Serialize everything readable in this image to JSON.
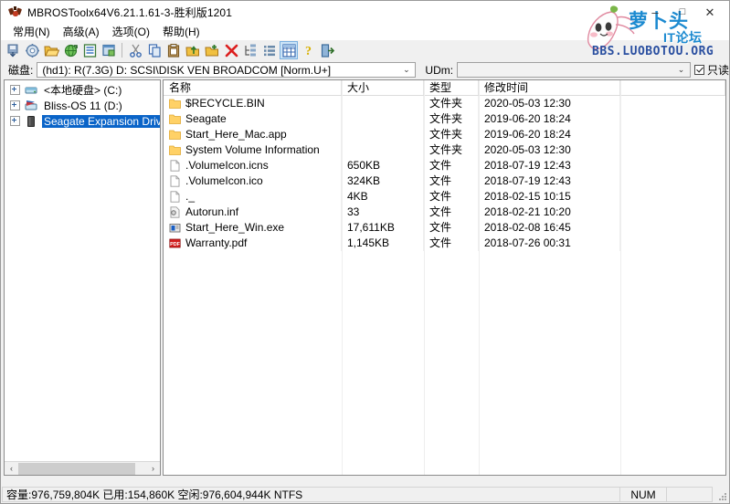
{
  "window": {
    "title": "MBROSToolx64V6.21.1.61-3-胜利版1201",
    "app_icon": "moth-icon",
    "minimize": "–",
    "maximize": "□",
    "close": "✕"
  },
  "menu": [
    {
      "label": "常用(N)",
      "name": "menu-common"
    },
    {
      "label": "高级(A)",
      "name": "menu-advanced"
    },
    {
      "label": "选项(O)",
      "name": "menu-options"
    },
    {
      "label": "帮助(H)",
      "name": "menu-help"
    }
  ],
  "toolbar": {
    "buttons": [
      {
        "name": "save-disk-icon"
      },
      {
        "name": "settings-gear-icon"
      },
      {
        "name": "open-folder-icon"
      },
      {
        "name": "refresh-globe-icon"
      },
      {
        "name": "list-properties-icon"
      },
      {
        "name": "export-window-icon"
      },
      {
        "name": "separator-1"
      },
      {
        "name": "cut-icon"
      },
      {
        "name": "copy-icon"
      },
      {
        "name": "paste-icon"
      },
      {
        "name": "upload-folder-icon"
      },
      {
        "name": "new-folder-icon"
      },
      {
        "name": "delete-x-icon"
      },
      {
        "name": "tree-view-icon"
      },
      {
        "name": "detail-list-icon"
      },
      {
        "name": "grid-view-icon"
      },
      {
        "name": "help-question-icon"
      },
      {
        "name": "exit-door-icon"
      }
    ],
    "active_index": 15
  },
  "disk_bar": {
    "label": "磁盘:",
    "value": "(hd1): R(7.3G)  D: SCSI\\DISK  VEN BROADCOM [Norm.U+]",
    "udm_label": "UDm:",
    "udm_value": "",
    "readonly_label": "只读",
    "readonly_checked": true,
    "dropdown_arrow": "⌄"
  },
  "tree": {
    "items": [
      {
        "label": "<本地硬盘> (C:)",
        "icon": "hdd-icon",
        "selected": false,
        "expander": "+"
      },
      {
        "label": "Bliss-OS 11 (D:)",
        "icon": "flag-drive-icon",
        "selected": false,
        "expander": "+"
      },
      {
        "label": "Seagate Expansion Drive (E",
        "icon": "external-drive-icon",
        "selected": true,
        "expander": "+"
      }
    ],
    "scroll_left": "‹",
    "scroll_right": "›"
  },
  "list": {
    "columns": [
      "名称",
      "大小",
      "类型",
      "修改时间"
    ],
    "rows": [
      {
        "name": "$RECYCLE.BIN",
        "size": "",
        "type": "文件夹",
        "time": "2020-05-03 12:30",
        "icon": "folder-icon"
      },
      {
        "name": "Seagate",
        "size": "",
        "type": "文件夹",
        "time": "2019-06-20 18:24",
        "icon": "folder-icon"
      },
      {
        "name": "Start_Here_Mac.app",
        "size": "",
        "type": "文件夹",
        "time": "2019-06-20 18:24",
        "icon": "folder-icon"
      },
      {
        "name": "System Volume Information",
        "size": "",
        "type": "文件夹",
        "time": "2020-05-03 12:30",
        "icon": "folder-icon"
      },
      {
        "name": ".VolumeIcon.icns",
        "size": "650KB",
        "type": "文件",
        "time": "2018-07-19 12:43",
        "icon": "file-icon"
      },
      {
        "name": ".VolumeIcon.ico",
        "size": "324KB",
        "type": "文件",
        "time": "2018-07-19 12:43",
        "icon": "file-icon"
      },
      {
        "name": "._",
        "size": "4KB",
        "type": "文件",
        "time": "2018-02-15 10:15",
        "icon": "file-icon"
      },
      {
        "name": "Autorun.inf",
        "size": "33",
        "type": "文件",
        "time": "2018-02-21 10:20",
        "icon": "inf-icon"
      },
      {
        "name": "Start_Here_Win.exe",
        "size": "17,611KB",
        "type": "文件",
        "time": "2018-02-08 16:45",
        "icon": "exe-icon"
      },
      {
        "name": "Warranty.pdf",
        "size": "1,145KB",
        "type": "文件",
        "time": "2018-07-26 00:31",
        "icon": "pdf-icon"
      }
    ]
  },
  "status": {
    "main": "容量:976,759,804K 已用:154,860K 空闲:976,604,944K NTFS",
    "num": "NUM",
    "pad": ""
  },
  "watermark": {
    "line1": "萝卜头",
    "line2": "IT论坛",
    "line3": "BBS.LUOBOTOU.ORG",
    "mascot": "radish-mascot-icon"
  },
  "colors": {
    "accent": "#0a64c8",
    "toolbar_active": "#cce4f7",
    "folder": "#ffd166",
    "watermark_blue": "#1c8ad0",
    "pdf_red": "#d41f1f"
  }
}
